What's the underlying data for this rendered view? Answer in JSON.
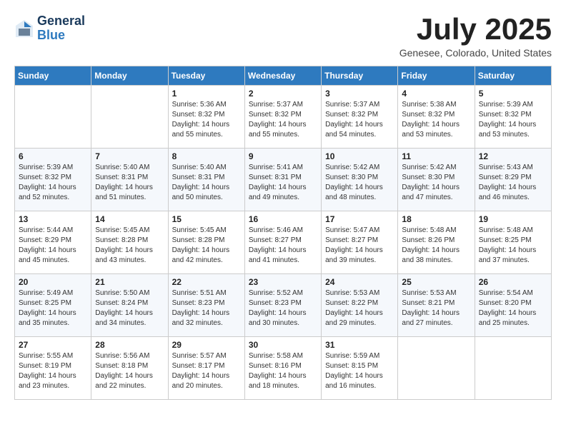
{
  "header": {
    "logo": {
      "general": "General",
      "blue": "Blue"
    },
    "title": "July 2025",
    "location": "Genesee, Colorado, United States"
  },
  "calendar": {
    "days_of_week": [
      "Sunday",
      "Monday",
      "Tuesday",
      "Wednesday",
      "Thursday",
      "Friday",
      "Saturday"
    ],
    "weeks": [
      [
        {
          "day": "",
          "sunrise": "",
          "sunset": "",
          "daylight": ""
        },
        {
          "day": "",
          "sunrise": "",
          "sunset": "",
          "daylight": ""
        },
        {
          "day": "1",
          "sunrise": "Sunrise: 5:36 AM",
          "sunset": "Sunset: 8:32 PM",
          "daylight": "Daylight: 14 hours and 55 minutes."
        },
        {
          "day": "2",
          "sunrise": "Sunrise: 5:37 AM",
          "sunset": "Sunset: 8:32 PM",
          "daylight": "Daylight: 14 hours and 55 minutes."
        },
        {
          "day": "3",
          "sunrise": "Sunrise: 5:37 AM",
          "sunset": "Sunset: 8:32 PM",
          "daylight": "Daylight: 14 hours and 54 minutes."
        },
        {
          "day": "4",
          "sunrise": "Sunrise: 5:38 AM",
          "sunset": "Sunset: 8:32 PM",
          "daylight": "Daylight: 14 hours and 53 minutes."
        },
        {
          "day": "5",
          "sunrise": "Sunrise: 5:39 AM",
          "sunset": "Sunset: 8:32 PM",
          "daylight": "Daylight: 14 hours and 53 minutes."
        }
      ],
      [
        {
          "day": "6",
          "sunrise": "Sunrise: 5:39 AM",
          "sunset": "Sunset: 8:32 PM",
          "daylight": "Daylight: 14 hours and 52 minutes."
        },
        {
          "day": "7",
          "sunrise": "Sunrise: 5:40 AM",
          "sunset": "Sunset: 8:31 PM",
          "daylight": "Daylight: 14 hours and 51 minutes."
        },
        {
          "day": "8",
          "sunrise": "Sunrise: 5:40 AM",
          "sunset": "Sunset: 8:31 PM",
          "daylight": "Daylight: 14 hours and 50 minutes."
        },
        {
          "day": "9",
          "sunrise": "Sunrise: 5:41 AM",
          "sunset": "Sunset: 8:31 PM",
          "daylight": "Daylight: 14 hours and 49 minutes."
        },
        {
          "day": "10",
          "sunrise": "Sunrise: 5:42 AM",
          "sunset": "Sunset: 8:30 PM",
          "daylight": "Daylight: 14 hours and 48 minutes."
        },
        {
          "day": "11",
          "sunrise": "Sunrise: 5:42 AM",
          "sunset": "Sunset: 8:30 PM",
          "daylight": "Daylight: 14 hours and 47 minutes."
        },
        {
          "day": "12",
          "sunrise": "Sunrise: 5:43 AM",
          "sunset": "Sunset: 8:29 PM",
          "daylight": "Daylight: 14 hours and 46 minutes."
        }
      ],
      [
        {
          "day": "13",
          "sunrise": "Sunrise: 5:44 AM",
          "sunset": "Sunset: 8:29 PM",
          "daylight": "Daylight: 14 hours and 45 minutes."
        },
        {
          "day": "14",
          "sunrise": "Sunrise: 5:45 AM",
          "sunset": "Sunset: 8:28 PM",
          "daylight": "Daylight: 14 hours and 43 minutes."
        },
        {
          "day": "15",
          "sunrise": "Sunrise: 5:45 AM",
          "sunset": "Sunset: 8:28 PM",
          "daylight": "Daylight: 14 hours and 42 minutes."
        },
        {
          "day": "16",
          "sunrise": "Sunrise: 5:46 AM",
          "sunset": "Sunset: 8:27 PM",
          "daylight": "Daylight: 14 hours and 41 minutes."
        },
        {
          "day": "17",
          "sunrise": "Sunrise: 5:47 AM",
          "sunset": "Sunset: 8:27 PM",
          "daylight": "Daylight: 14 hours and 39 minutes."
        },
        {
          "day": "18",
          "sunrise": "Sunrise: 5:48 AM",
          "sunset": "Sunset: 8:26 PM",
          "daylight": "Daylight: 14 hours and 38 minutes."
        },
        {
          "day": "19",
          "sunrise": "Sunrise: 5:48 AM",
          "sunset": "Sunset: 8:25 PM",
          "daylight": "Daylight: 14 hours and 37 minutes."
        }
      ],
      [
        {
          "day": "20",
          "sunrise": "Sunrise: 5:49 AM",
          "sunset": "Sunset: 8:25 PM",
          "daylight": "Daylight: 14 hours and 35 minutes."
        },
        {
          "day": "21",
          "sunrise": "Sunrise: 5:50 AM",
          "sunset": "Sunset: 8:24 PM",
          "daylight": "Daylight: 14 hours and 34 minutes."
        },
        {
          "day": "22",
          "sunrise": "Sunrise: 5:51 AM",
          "sunset": "Sunset: 8:23 PM",
          "daylight": "Daylight: 14 hours and 32 minutes."
        },
        {
          "day": "23",
          "sunrise": "Sunrise: 5:52 AM",
          "sunset": "Sunset: 8:23 PM",
          "daylight": "Daylight: 14 hours and 30 minutes."
        },
        {
          "day": "24",
          "sunrise": "Sunrise: 5:53 AM",
          "sunset": "Sunset: 8:22 PM",
          "daylight": "Daylight: 14 hours and 29 minutes."
        },
        {
          "day": "25",
          "sunrise": "Sunrise: 5:53 AM",
          "sunset": "Sunset: 8:21 PM",
          "daylight": "Daylight: 14 hours and 27 minutes."
        },
        {
          "day": "26",
          "sunrise": "Sunrise: 5:54 AM",
          "sunset": "Sunset: 8:20 PM",
          "daylight": "Daylight: 14 hours and 25 minutes."
        }
      ],
      [
        {
          "day": "27",
          "sunrise": "Sunrise: 5:55 AM",
          "sunset": "Sunset: 8:19 PM",
          "daylight": "Daylight: 14 hours and 23 minutes."
        },
        {
          "day": "28",
          "sunrise": "Sunrise: 5:56 AM",
          "sunset": "Sunset: 8:18 PM",
          "daylight": "Daylight: 14 hours and 22 minutes."
        },
        {
          "day": "29",
          "sunrise": "Sunrise: 5:57 AM",
          "sunset": "Sunset: 8:17 PM",
          "daylight": "Daylight: 14 hours and 20 minutes."
        },
        {
          "day": "30",
          "sunrise": "Sunrise: 5:58 AM",
          "sunset": "Sunset: 8:16 PM",
          "daylight": "Daylight: 14 hours and 18 minutes."
        },
        {
          "day": "31",
          "sunrise": "Sunrise: 5:59 AM",
          "sunset": "Sunset: 8:15 PM",
          "daylight": "Daylight: 14 hours and 16 minutes."
        },
        {
          "day": "",
          "sunrise": "",
          "sunset": "",
          "daylight": ""
        },
        {
          "day": "",
          "sunrise": "",
          "sunset": "",
          "daylight": ""
        }
      ]
    ]
  }
}
